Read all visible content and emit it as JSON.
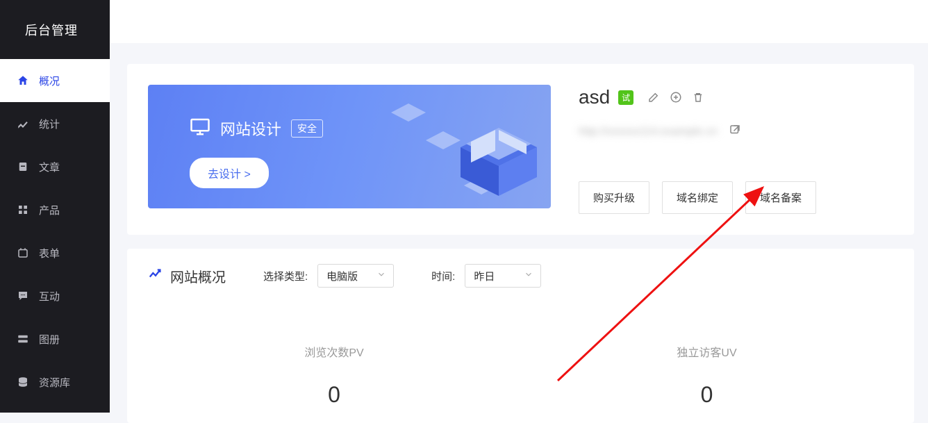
{
  "sidebar": {
    "title": "后台管理",
    "items": [
      {
        "label": "概况",
        "icon": "home"
      },
      {
        "label": "统计",
        "icon": "chart"
      },
      {
        "label": "文章",
        "icon": "doc"
      },
      {
        "label": "产品",
        "icon": "grid"
      },
      {
        "label": "表单",
        "icon": "calendar"
      },
      {
        "label": "互动",
        "icon": "comment"
      },
      {
        "label": "图册",
        "icon": "image"
      },
      {
        "label": "资源库",
        "icon": "database"
      }
    ]
  },
  "banner": {
    "title": "网站设计",
    "tag": "安全",
    "button": "去设计 >"
  },
  "site": {
    "name": "asd",
    "trial_badge": "试",
    "url_blurred": "http://xxxxxx114.example.cn",
    "buttons": {
      "upgrade": "购买升级",
      "bind": "域名绑定",
      "record": "域名备案"
    }
  },
  "overview": {
    "title": "网站概况",
    "filter_type_label": "选择类型:",
    "filter_type_value": "电脑版",
    "filter_time_label": "时间:",
    "filter_time_value": "昨日",
    "stats": {
      "pv_label": "浏览次数PV",
      "pv_value": "0",
      "uv_label": "独立访客UV",
      "uv_value": "0"
    }
  }
}
